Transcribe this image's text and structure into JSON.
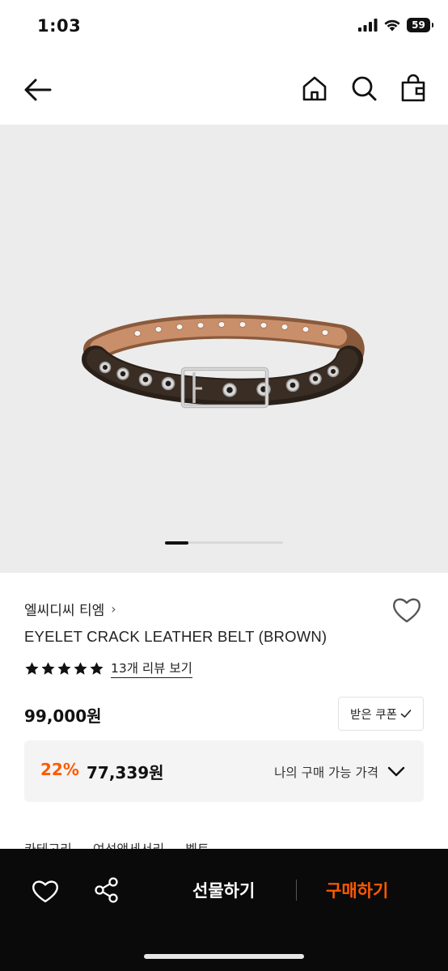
{
  "status": {
    "time": "1:03",
    "battery": "59"
  },
  "icons": {
    "back": "arrow-left-icon",
    "home": "home-icon",
    "search": "search-icon",
    "bag": "shopping-bag-icon",
    "wishlist": "heart-icon",
    "share": "share-icon",
    "review_star": "star-icon"
  },
  "product": {
    "brand": "엘씨디씨 티엠",
    "brand_chevron": "›",
    "name": "EYELET CRACK LEATHER BELT (BROWN)",
    "rating_stars": 5,
    "review_link": "13개 리뷰 보기",
    "price": "99,000원",
    "coupon_button": "받은 쿠폰",
    "discount_percent": "22%",
    "discount_price": "77,339원",
    "discount_label": "나의 구매 가능 가격",
    "categories": [
      "카테고리",
      "여성액세서리",
      "벨트"
    ]
  },
  "gallery": {
    "current": 1,
    "total": 5
  },
  "bottom_bar": {
    "gift_label": "선물하기",
    "buy_label": "구매하기"
  },
  "colors": {
    "accent": "#ff5a00",
    "bottom_bar_bg": "#0a0a0a",
    "image_bg": "#ececec"
  }
}
